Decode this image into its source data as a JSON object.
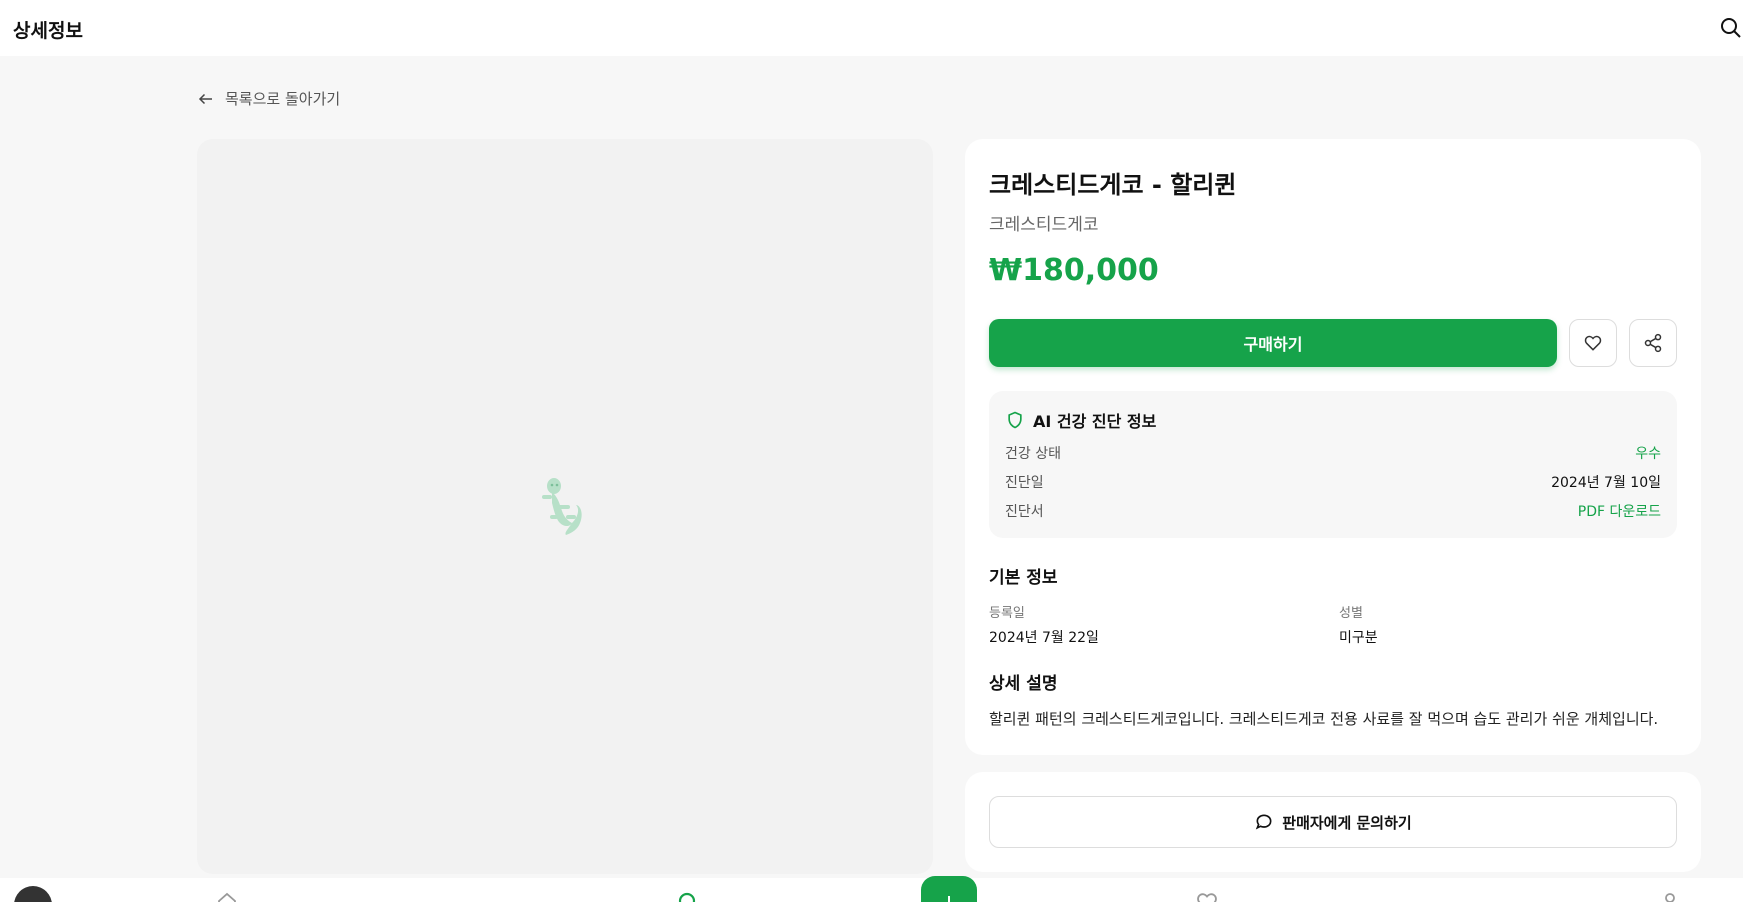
{
  "header": {
    "title": "상세정보"
  },
  "back": {
    "label": "목록으로 돌아가기"
  },
  "product": {
    "name": "크레스티드게코 - 할리퀸",
    "species": "크레스티드게코",
    "price": "₩180,000"
  },
  "actions": {
    "buy_label": "구매하기"
  },
  "health": {
    "title": "AI 건강 진단 정보",
    "rows": [
      {
        "label": "건강 상태",
        "value": "우수"
      },
      {
        "label": "진단일",
        "value": "2024년 7월 10일"
      },
      {
        "label": "진단서",
        "value": "PDF 다운로드"
      }
    ]
  },
  "basic": {
    "title": "기본 정보",
    "fields": [
      {
        "label": "등록일",
        "value": "2024년 7월 22일"
      },
      {
        "label": "성별",
        "value": "미구분"
      }
    ]
  },
  "description": {
    "title": "상세 설명",
    "text": "할리퀸 패턴의 크레스티드게코입니다. 크레스티드게코 전용 사료를 잘 먹으며 습도 관리가 쉬운 개체입니다."
  },
  "contact": {
    "label": "판매자에게 문의하기"
  },
  "colors": {
    "accent": "#16a34a",
    "placeholder_icon": "#b7e0c8"
  },
  "icons": [
    "search-icon",
    "arrow-left-icon",
    "gecko-icon",
    "heart-icon",
    "share-icon",
    "shield-icon",
    "chat-bubble-icon",
    "home-icon",
    "plus-icon",
    "user-icon"
  ]
}
